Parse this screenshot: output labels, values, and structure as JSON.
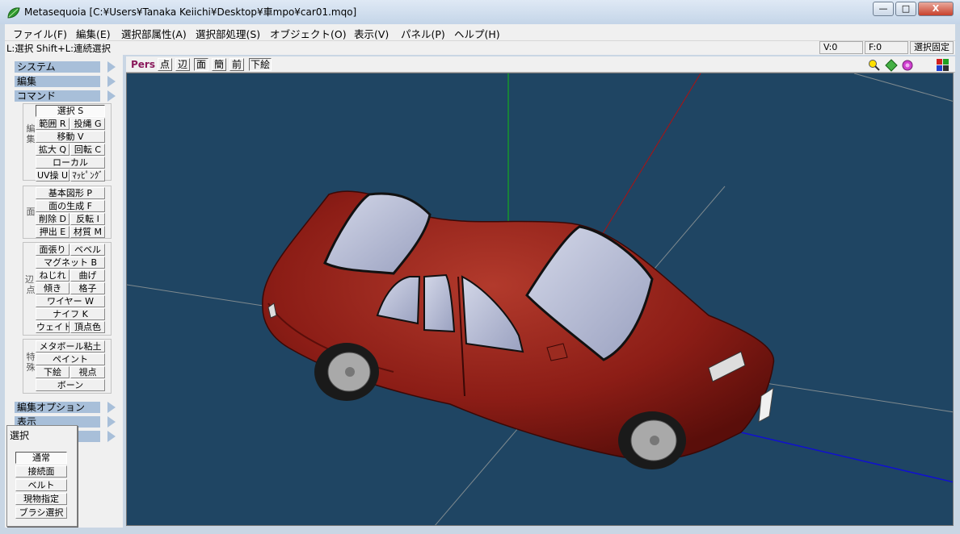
{
  "window": {
    "title": "Metasequoia [C:¥Users¥Tanaka Keiichi¥Desktop¥車mpo¥car01.mqo]",
    "minimize": "—",
    "maximize": "□",
    "close": "X"
  },
  "menu": [
    "ファイル(F)",
    "編集(E)",
    "選択部属性(A)",
    "選択部処理(S)",
    "オブジェクト(O)",
    "表示(V)",
    "パネル(P)",
    "ヘルプ(H)"
  ],
  "status": {
    "hint": "L:選択  Shift+L:連続選択",
    "vertices": "V:0",
    "faces": "F:0",
    "lock": "選択固定"
  },
  "panel": {
    "sections": {
      "system": "システム",
      "edit": "編集",
      "command": "コマンド",
      "edit_option": "編集オプション",
      "display": "表示",
      "object": "オブジェクト"
    },
    "group_labels": {
      "edit": "編集",
      "face": "面",
      "edge_vertex": "辺・点",
      "special": "特殊"
    },
    "edit_buttons": [
      "選択 S",
      "範囲 R",
      "投縄 G",
      "移動 V",
      "拡大 Q",
      "回転 C",
      "ローカル",
      "UV操 U",
      "ﾏｯﾋﾟﾝｸﾞ"
    ],
    "face_buttons": [
      "基本図形 P",
      "面の生成 F",
      "削除 D",
      "反転 I",
      "押出 E",
      "材質 M"
    ],
    "edge_buttons": [
      "面張り",
      "ベベル",
      "マグネット B",
      "ねじれ",
      "曲げ",
      "傾き",
      "格子",
      "ワイヤー W",
      "ナイフ K",
      "ウェイト",
      "頂点色"
    ],
    "special_buttons": [
      "メタボール粘土",
      "ペイント",
      "下絵",
      "視点",
      "ボーン"
    ]
  },
  "select_panel": {
    "title": "選択",
    "items": [
      "通常",
      "接続面",
      "ベルト",
      "現物指定",
      "ブラシ選択"
    ]
  },
  "view": {
    "mode": "Pers",
    "buttons": [
      "点",
      "辺",
      "面",
      "簡",
      "前"
    ],
    "underlay": "下絵",
    "icons": [
      "zoom-icon",
      "move-view-icon",
      "rotate-view-icon",
      "palette-icon"
    ]
  },
  "colors": {
    "viewport": "#1f4563",
    "car_body": "#8f1f18",
    "glass": "#b9bfd6",
    "axis_x": "#b01010",
    "axis_y": "#10b010",
    "axis_z": "#1010d0"
  }
}
